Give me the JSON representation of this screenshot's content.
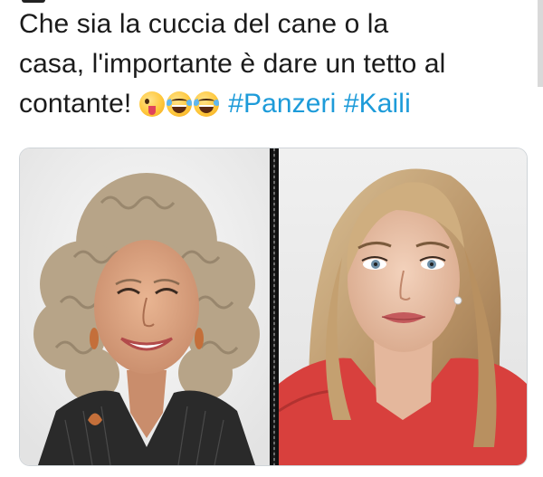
{
  "post": {
    "text_lines": [
      "Che sia la cuccia del cane o la",
      "casa, l'importante è dare un tetto al",
      "contante!"
    ],
    "emojis": [
      "zany-face",
      "face-with-tears-of-joy",
      "face-with-tears-of-joy"
    ],
    "hashtags": [
      "#Panzeri",
      "#Kaili"
    ]
  },
  "images": [
    {
      "name": "photo-left",
      "description_colors": {
        "background": "#f2f2f2",
        "hair": "#b8a58a",
        "jacket": "#2a2a2a"
      }
    },
    {
      "name": "photo-right",
      "description_colors": {
        "background": "#ededed",
        "hair": "#c9a97a",
        "top": "#d8403d"
      }
    }
  ],
  "colors": {
    "text": "#1b1b1b",
    "hashtag": "#1d9bd9",
    "border": "#cfd4d8"
  }
}
